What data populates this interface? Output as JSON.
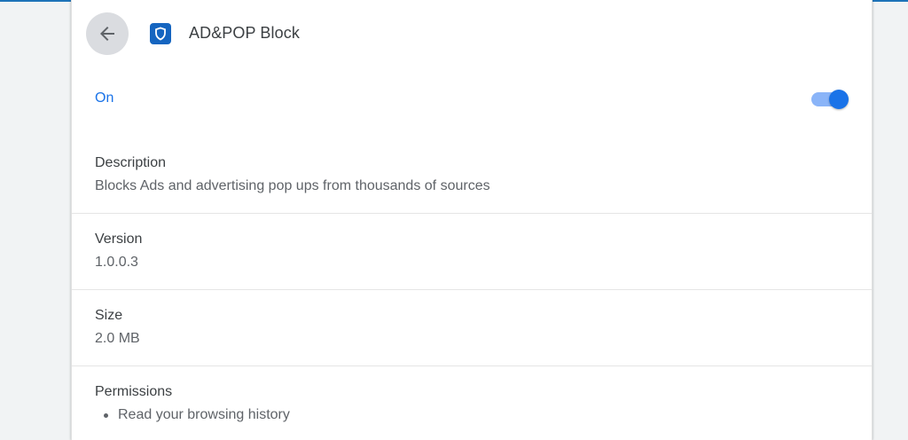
{
  "header": {
    "title": "AD&POP Block",
    "back_icon": "arrow-left-icon",
    "extension_icon": "shield-icon"
  },
  "toggle_row": {
    "label": "On",
    "enabled": true
  },
  "details": {
    "description": {
      "label": "Description",
      "value": "Blocks Ads and advertising pop ups from thousands of sources"
    },
    "version": {
      "label": "Version",
      "value": "1.0.0.3"
    },
    "size": {
      "label": "Size",
      "value": "2.0 MB"
    },
    "permissions": {
      "label": "Permissions",
      "items": [
        "Read your browsing history"
      ]
    }
  },
  "colors": {
    "accent": "#1a73e8",
    "toggle_track": "#8ab4f8",
    "icon_bg": "#1565c0",
    "page_bg": "#f1f3f4"
  }
}
